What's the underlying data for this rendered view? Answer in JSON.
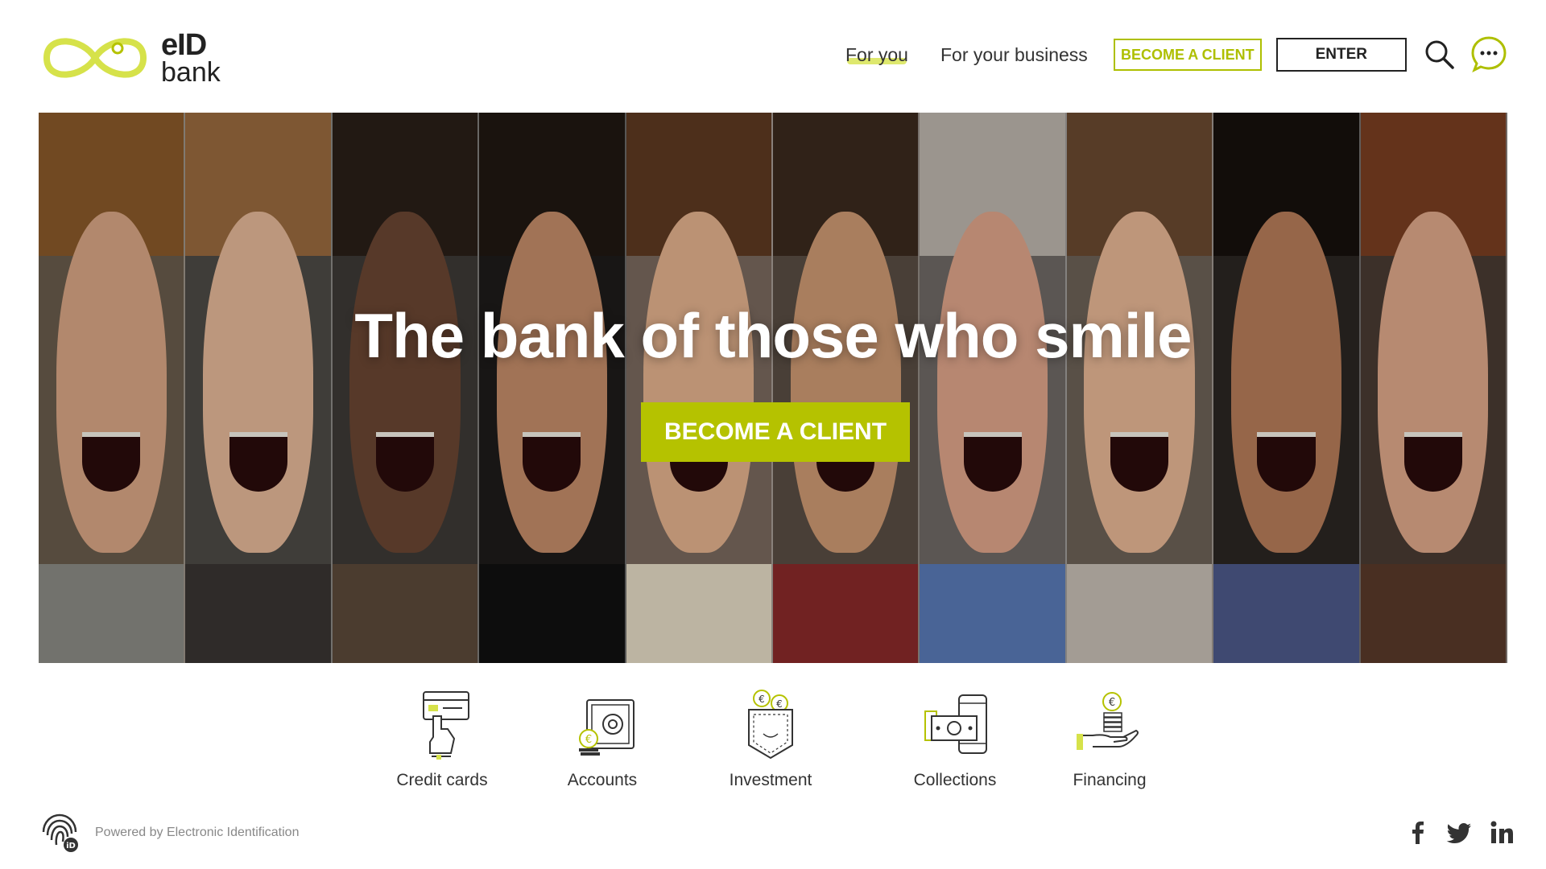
{
  "brand": {
    "logo_line1": "eID",
    "logo_line2": "bank",
    "accent_color": "#b5c200",
    "logo_color": "#d6e24a"
  },
  "nav": {
    "for_you": "For you",
    "for_business": "For your business",
    "become_client": "BECOME A CLIENT",
    "enter": "ENTER",
    "search_icon": "search-icon",
    "chat_icon": "chat-icon"
  },
  "hero": {
    "title": "The bank of those who smile",
    "cta": "BECOME A CLIENT"
  },
  "categories": [
    {
      "label": "Credit cards",
      "icon": "credit-card-icon"
    },
    {
      "label": "Accounts",
      "icon": "safe-icon"
    },
    {
      "label": "Investment",
      "icon": "pocket-coins-icon"
    },
    {
      "label": "Collections",
      "icon": "phone-payment-icon"
    },
    {
      "label": "Financing",
      "icon": "hand-coins-icon"
    }
  ],
  "footer": {
    "powered_by": "Powered by Electronic Identification",
    "social": [
      "facebook-icon",
      "twitter-icon",
      "linkedin-icon"
    ]
  }
}
